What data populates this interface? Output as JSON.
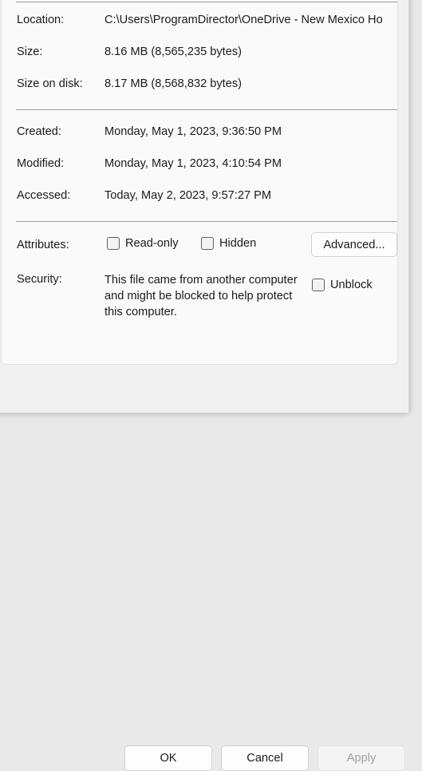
{
  "dialog": {
    "info_rows": [
      {
        "label": "Location:",
        "value": "C:\\Users\\ProgramDirector\\OneDrive - New Mexico Ho"
      },
      {
        "label": "Size:",
        "value": "8.16 MB (8,565,235 bytes)"
      },
      {
        "label": "Size on disk:",
        "value": "8.17 MB (8,568,832 bytes)"
      }
    ],
    "date_rows": [
      {
        "label": "Created:",
        "value": "Monday, May 1, 2023, 9:36:50 PM"
      },
      {
        "label": "Modified:",
        "value": "Monday, May 1, 2023, 4:10:54 PM"
      },
      {
        "label": "Accessed:",
        "value": "Today, May 2, 2023, 9:57:27 PM"
      }
    ],
    "attributes": {
      "label": "Attributes:",
      "read_only": {
        "label": "Read-only",
        "checked": false
      },
      "hidden": {
        "label": "Hidden",
        "checked": false
      },
      "advanced_button": "Advanced..."
    },
    "security": {
      "label": "Security:",
      "message": "This file came from another computer and might be blocked to help protect this computer.",
      "unblock": {
        "label": "Unblock",
        "checked": false
      }
    },
    "footer": {
      "ok": "OK",
      "cancel": "Cancel",
      "apply": "Apply",
      "apply_disabled": true
    }
  },
  "colors": {
    "window_background": "#f0f0f0",
    "content_background": "#fafafa",
    "text": "#1b1b1b",
    "disabled_text": "#a0a0a0",
    "separator": "#9e9e9e",
    "border": "#d2d2d2"
  }
}
